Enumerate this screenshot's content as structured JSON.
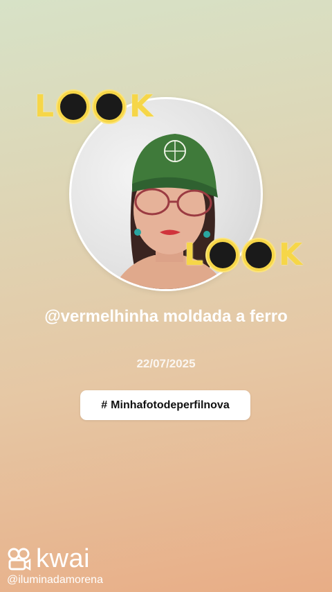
{
  "profile": {
    "username": "@vermelhinha moldada a ferro",
    "date": "22/07/2025",
    "hashtag_symbol": "#",
    "hashtag": "Minhafotodeperfilnova"
  },
  "stickers": {
    "top": {
      "l": "L",
      "k": "K"
    },
    "bottom": {
      "l": "L",
      "k": "K"
    }
  },
  "watermark": {
    "brand": "kwai",
    "handle": "@iluminadamorena"
  },
  "colors": {
    "sticker_yellow": "#f6d648",
    "text": "#ffffff"
  }
}
